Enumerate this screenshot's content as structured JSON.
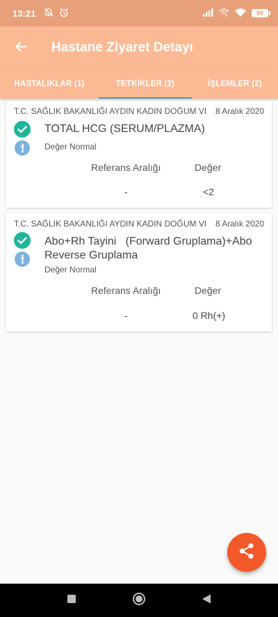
{
  "status_bar": {
    "time": "13:21",
    "battery": "90",
    "icons": [
      "mute-bell-icon",
      "alarm-icon",
      "signal-icon",
      "wifi-calling-icon",
      "wifi-icon",
      "battery-icon"
    ]
  },
  "app_bar": {
    "back_icon": "arrow-left-icon",
    "title": "Hastane Ziyaret Detayı"
  },
  "tabs": [
    {
      "label": "HASTALIKLAR (1)",
      "active": false
    },
    {
      "label": "TETKİKLER (2)",
      "active": true
    },
    {
      "label": "İŞLEMLER (2)",
      "active": false
    }
  ],
  "results": [
    {
      "hospital": "T.C. SAĞLIK BAKANLIĞI AYDIN KADIN DOĞUM VE",
      "date": "8 Aralık 2020",
      "test_name": "TOTAL HCG (SERUM/PLAZMA)",
      "note": "Değer Normal",
      "reference_header": "Referans Aralığı",
      "value_header": "Değer",
      "reference_value": "-",
      "value": "<2"
    },
    {
      "hospital": "T.C. SAĞLIK BAKANLIĞI AYDIN KADIN DOĞUM VE",
      "date": "8 Aralık 2020",
      "test_name": "Abo+Rh Tayini   (Forward Gruplama)+Abo Reverse Gruplama",
      "note": "Değer Normal",
      "reference_header": "Referans Aralığı",
      "value_header": "Değer",
      "reference_value": "-",
      "value": "0 Rh(+)"
    }
  ],
  "fab": {
    "icon": "share-icon"
  },
  "colors": {
    "status_bar": "#e8a07b",
    "app_bar": "#fcba94",
    "tab_indicator": "#5b8fa8",
    "check": "#1fb59a",
    "info": "#7fb1dd",
    "fab": "#f4592b"
  },
  "nav_bar": {
    "icons": [
      "recents-square-icon",
      "home-circle-icon",
      "back-triangle-icon"
    ]
  }
}
